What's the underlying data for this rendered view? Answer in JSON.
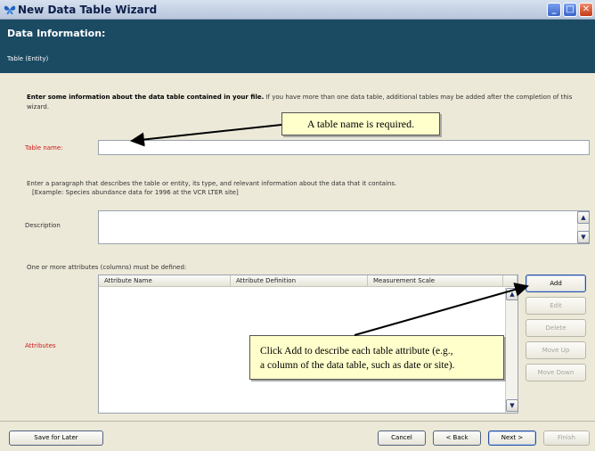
{
  "window": {
    "title": "New Data Table Wizard",
    "icon": "butterfly-icon",
    "controls": [
      "minimize-icon",
      "maximize-icon",
      "close-icon"
    ]
  },
  "header": {
    "title": "Data Information:",
    "subtitle": "Table (Entity)"
  },
  "intro": {
    "bold": "Enter some information about the data table contained in your file.",
    "rest": " If you have more than one data table, additional tables may be added after the completion of this wizard."
  },
  "table_name": {
    "label": "Table name:",
    "value": "",
    "callout": "A table name is required."
  },
  "description": {
    "instruction": "Enter a paragraph that describes the table or entity, its type, and relevant information about the data that it contains.",
    "example": "[Example:  Species abundance data for 1996 at the VCR LTER site]",
    "label": "Description",
    "value": ""
  },
  "attributes": {
    "instruction": "One or more attributes (columns) must be defined:",
    "label": "Attributes",
    "columns": [
      "Attribute Name",
      "Attribute Definition",
      "Measurement Scale"
    ],
    "rows": [],
    "callout_line1": "Click Add to describe each table attribute (e.g.,",
    "callout_line2": "a column of the data table, such as date or site).",
    "buttons": {
      "add": "Add",
      "edit": "Edit",
      "delete": "Delete",
      "move_up": "Move Up",
      "move_down": "Move Down"
    }
  },
  "footer": {
    "save_for_later": "Save for Later",
    "cancel": "Cancel",
    "back": "< Back",
    "next": "Next >",
    "finish": "Finish"
  },
  "colors": {
    "header_band": "#1b4a63",
    "required_label": "#d01818",
    "callout_bg": "#ffffcc"
  }
}
